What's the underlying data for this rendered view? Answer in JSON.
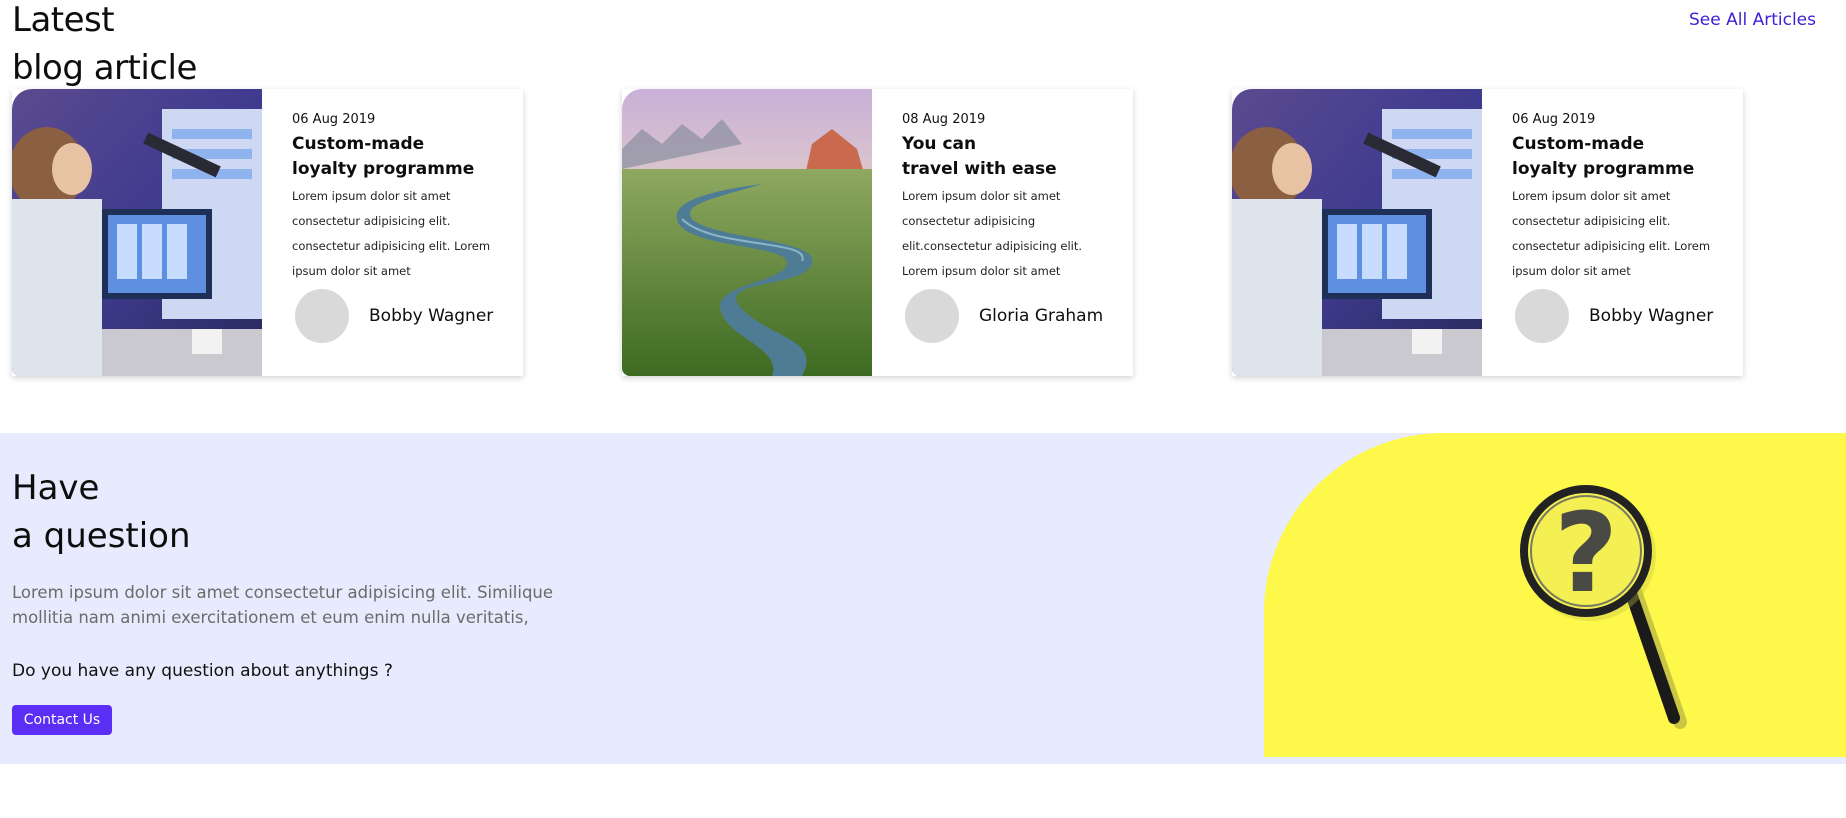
{
  "blog": {
    "title_line1": "Latest",
    "title_line2": "blog article",
    "see_all": "See All Articles",
    "cards": [
      {
        "date": "06 Aug 2019",
        "title_line1": "Custom-made",
        "title_line2": "loyalty programme",
        "excerpt": "Lorem ipsum dolor sit amet consectetur adipisicing elit. consectetur adipisicing elit. Lorem ipsum dolor sit amet",
        "author": "Bobby Wagner",
        "image": "person-at-computer-image"
      },
      {
        "date": "08 Aug 2019",
        "title_line1": "You can",
        "title_line2": "travel with ease",
        "excerpt": "Lorem ipsum dolor sit amet consectetur adipisicing elit.consectetur adipisicing elit. Lorem ipsum dolor sit amet",
        "author": "Gloria Graham",
        "image": "river-landscape-image"
      },
      {
        "date": "06 Aug 2019",
        "title_line1": "Custom-made",
        "title_line2": "loyalty programme",
        "excerpt": "Lorem ipsum dolor sit amet consectetur adipisicing elit. consectetur adipisicing elit. Lorem ipsum dolor sit amet",
        "author": "Bobby Wagner",
        "image": "person-at-computer-image"
      }
    ]
  },
  "question": {
    "title_line1": "Have",
    "title_line2": "a question",
    "description": "Lorem ipsum dolor sit amet consectetur adipisicing elit. Similique mollitia nam animi exercitationem et eum enim nulla veritatis,",
    "ask": "Do you have any question about anythings ?",
    "button": "Contact Us",
    "image": "magnifier-question-image"
  },
  "colors": {
    "accent": "#5a2ef5",
    "link": "#3d1fd6",
    "question_bg": "#e8ebfd",
    "yellow": "#fdf84a"
  }
}
